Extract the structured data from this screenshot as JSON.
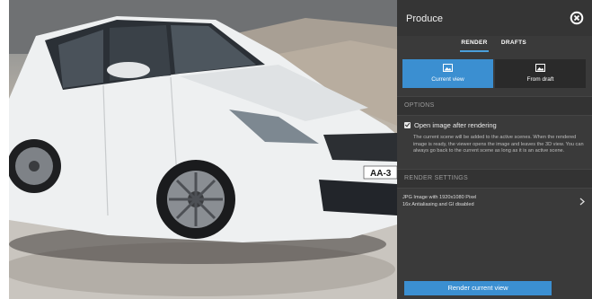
{
  "viewport": {
    "license_plate": "AA-3"
  },
  "panel": {
    "title": "Produce",
    "tabs": [
      {
        "label": "RENDER",
        "active": true
      },
      {
        "label": "DRAFTS",
        "active": false
      }
    ],
    "modes": [
      {
        "label": "Current view",
        "icon": "image-icon",
        "active": true
      },
      {
        "label": "From draft",
        "icon": "image-icon",
        "active": false
      }
    ],
    "options_header": "OPTIONS",
    "open_after_render_label": "Open image after rendering",
    "open_after_render_checked": true,
    "description": "The current scene will be added to the active scenes. When the rendered image is ready, the viewer opens the image and leaves the 3D view. You can always go back to the current scene as long as it is an active scene.",
    "render_settings_header": "RENDER SETTINGS",
    "render_settings_line1": "JPG Image with 1920x1080 Pixel",
    "render_settings_line2": "16x Antialiasing and GI disabled",
    "render_button": "Render current view",
    "accent_color": "#3b8fd1"
  }
}
